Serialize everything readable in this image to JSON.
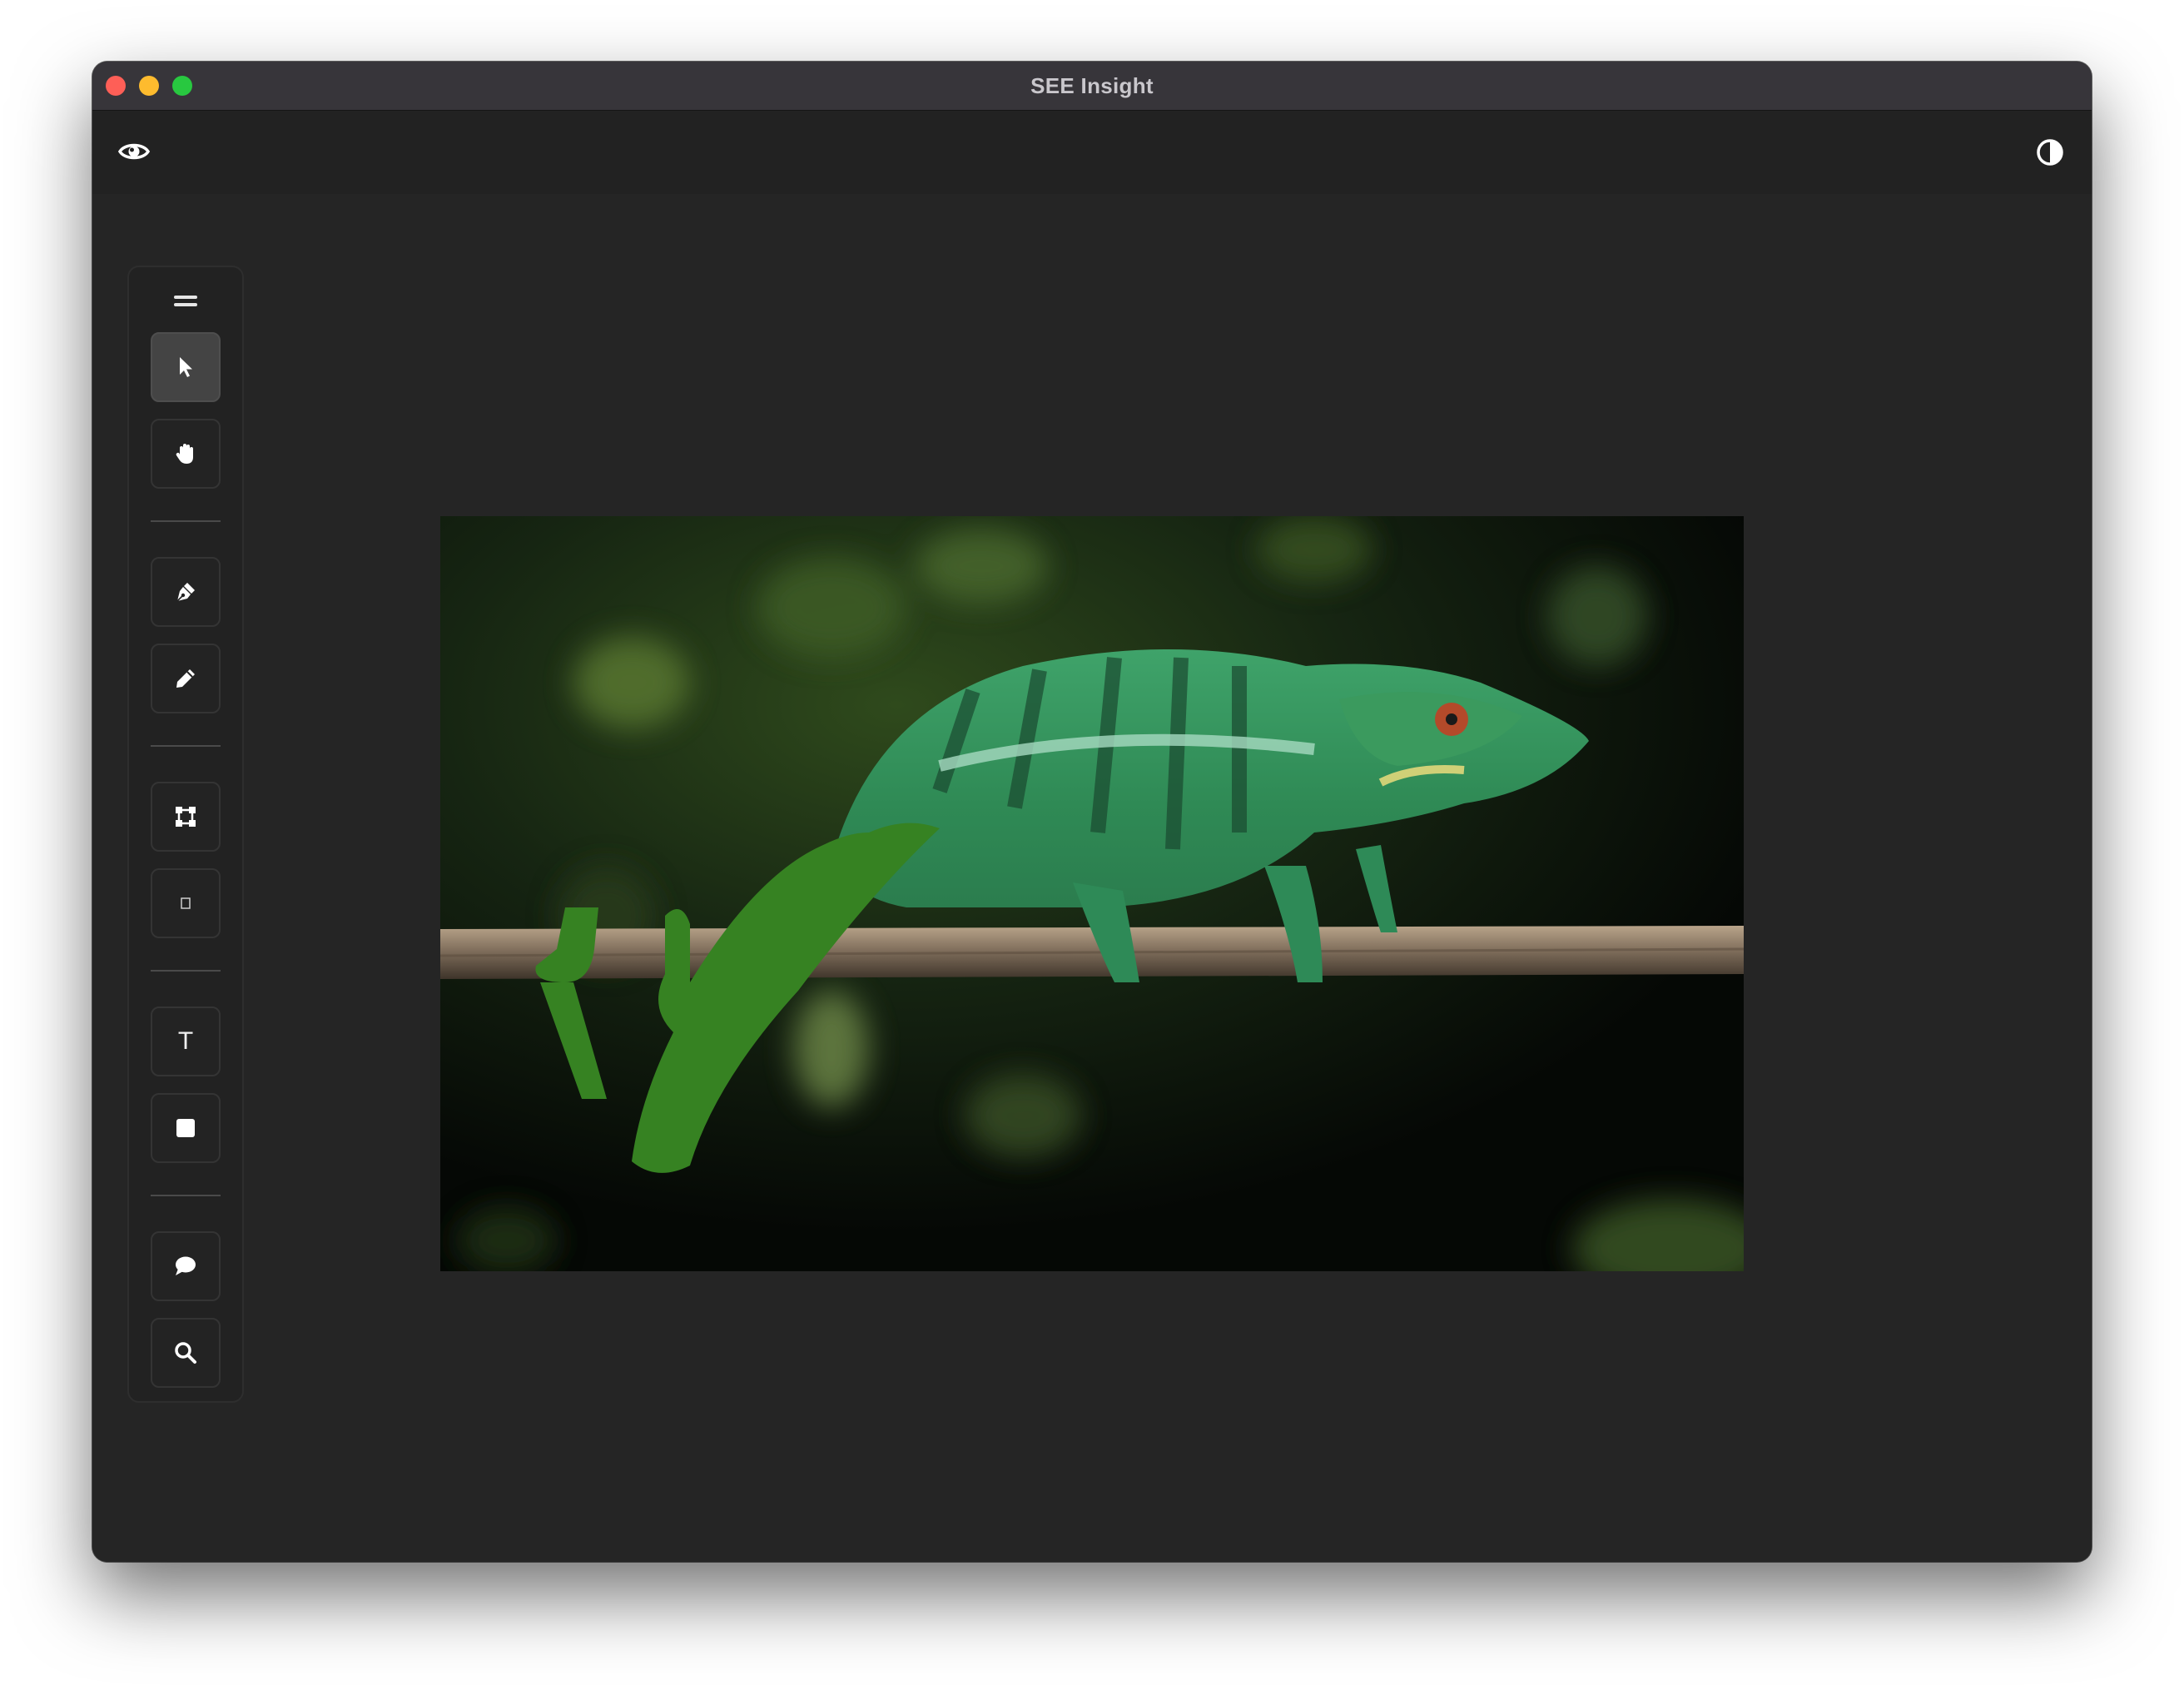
{
  "window": {
    "title": "SEE Insight",
    "traffic_lights": [
      "close",
      "minimize",
      "zoom"
    ]
  },
  "header": {
    "left_icon": "eye-icon",
    "right_icon": "contrast-toggle-icon"
  },
  "toolbar": {
    "handle_icon": "drag-handle-icon",
    "groups": [
      [
        {
          "id": "select",
          "icon": "arrow-pointer-icon",
          "active": true
        },
        {
          "id": "pan",
          "icon": "hand-icon",
          "active": false
        }
      ],
      [
        {
          "id": "pen",
          "icon": "pen-nib-icon",
          "active": false
        },
        {
          "id": "pencil",
          "icon": "pencil-icon",
          "active": false
        }
      ],
      [
        {
          "id": "polygon",
          "icon": "bounding-box-icon",
          "active": false
        },
        {
          "id": "rectangle",
          "icon": "rectangle-outline-icon",
          "active": false
        }
      ],
      [
        {
          "id": "text",
          "icon": "text-icon",
          "label": "T",
          "active": false
        },
        {
          "id": "fill",
          "icon": "filled-square-icon",
          "active": false
        }
      ],
      [
        {
          "id": "comment",
          "icon": "speech-bubble-icon",
          "active": false
        },
        {
          "id": "zoom",
          "icon": "magnifier-icon",
          "active": false
        }
      ]
    ]
  },
  "canvas": {
    "image_subject": "chameleon-on-branch",
    "annotation_color": "#368222"
  },
  "colors": {
    "window_bg": "#252525",
    "titlebar": "#37353a",
    "tool_active": "#444444"
  }
}
